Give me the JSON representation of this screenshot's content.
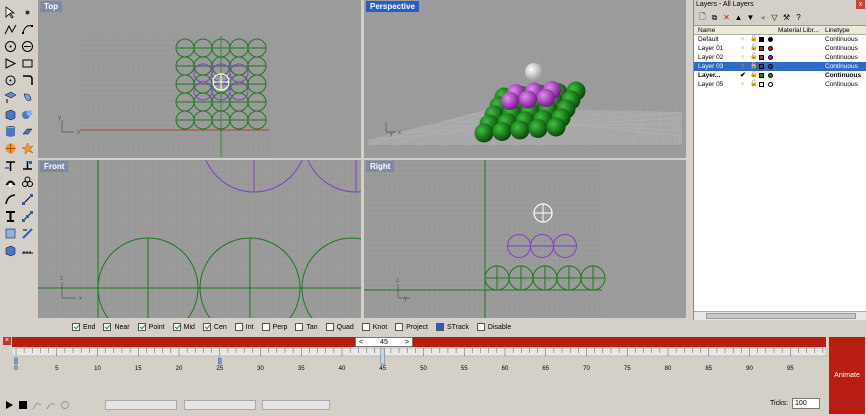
{
  "viewports": {
    "top": "Top",
    "perspective": "Perspective",
    "front": "Front",
    "right": "Right"
  },
  "layers": {
    "title": "Layers - All Layers",
    "close": "x",
    "toolbar_icons": [
      "new-layer-icon",
      "new-sublayer-icon",
      "delete-icon",
      "move-up-icon",
      "move-down-icon",
      "move-out-icon",
      "filter-icon",
      "tools-icon",
      "help-icon"
    ],
    "columns": [
      "Name",
      "Material Libr...",
      "Linetype"
    ],
    "rows": [
      {
        "name": "Default",
        "color": "#000000",
        "linetype": "Continuous",
        "selected": false,
        "current": false
      },
      {
        "name": "Layer 01",
        "color": "#e01010",
        "linetype": "Continuous",
        "selected": false,
        "current": false
      },
      {
        "name": "Layer 02",
        "color": "#a020c0",
        "linetype": "Continuous",
        "selected": false,
        "current": false
      },
      {
        "name": "Layer 03",
        "color": "#2a40c8",
        "linetype": "Continuous",
        "selected": true,
        "current": false
      },
      {
        "name": "Layer...",
        "color": "#1a8a1a",
        "linetype": "Continuous",
        "selected": false,
        "current": true
      },
      {
        "name": "Layer 05",
        "color": "#ffffff",
        "linetype": "Continuous",
        "selected": false,
        "current": false
      }
    ]
  },
  "osnap": [
    {
      "label": "End",
      "on": true
    },
    {
      "label": "Near",
      "on": true
    },
    {
      "label": "Point",
      "on": true
    },
    {
      "label": "Mid",
      "on": true
    },
    {
      "label": "Cen",
      "on": true
    },
    {
      "label": "Int",
      "on": false
    },
    {
      "label": "Perp",
      "on": false
    },
    {
      "label": "Tan",
      "on": false
    },
    {
      "label": "Quad",
      "on": false
    },
    {
      "label": "Knot",
      "on": false
    },
    {
      "label": "Project",
      "on": false
    },
    {
      "label": "STrack",
      "on": true
    },
    {
      "label": "Disable",
      "on": false
    }
  ],
  "timeline": {
    "current_frame": "45",
    "prev": "<",
    "next": ">",
    "ruler_labels": [
      "0",
      "5",
      "10",
      "15",
      "20",
      "25",
      "30",
      "35",
      "40",
      "45",
      "50",
      "55",
      "60",
      "65",
      "70",
      "75",
      "80",
      "85",
      "90",
      "95"
    ],
    "keyframes": [
      "0",
      "25",
      "45"
    ],
    "animate_label": "Animate",
    "ticks_label": "Ticks:",
    "ticks_value": "100"
  }
}
